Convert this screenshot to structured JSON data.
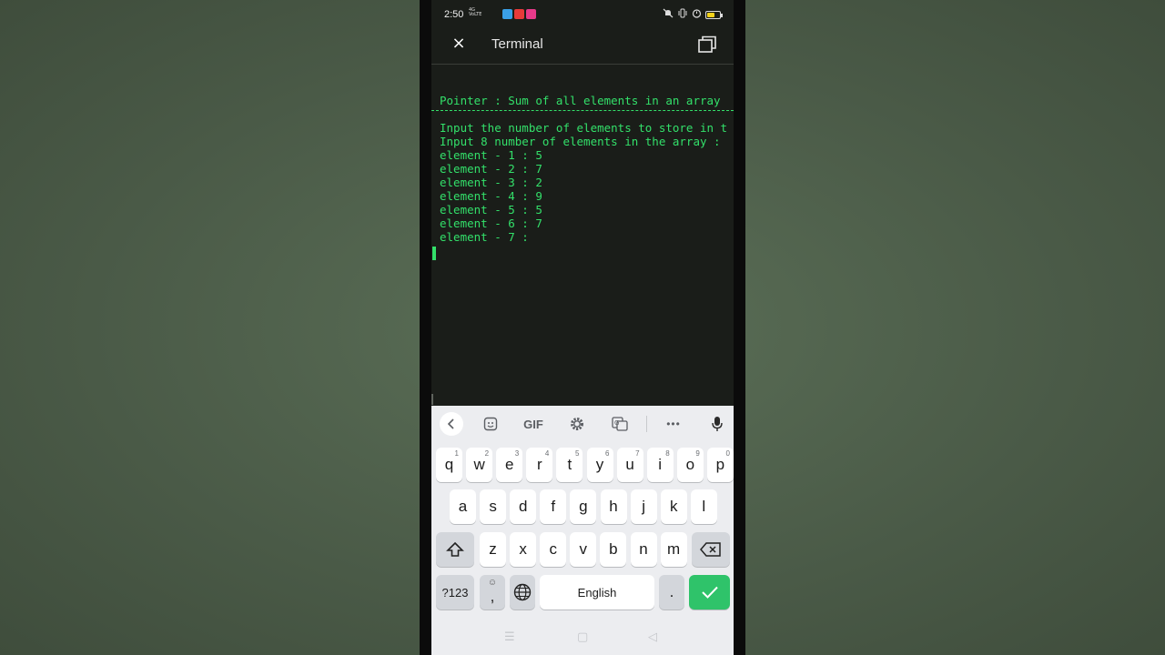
{
  "status_bar": {
    "time": "2:50",
    "net_top": "4G",
    "net_bottom": "VoLTE",
    "notification_colors": [
      "#3aa0e8",
      "#e83a3a",
      "#e83a8a"
    ],
    "battery_level": 0.6,
    "battery_color": "#f2d21b",
    "icons": [
      "mute-icon",
      "vibrate-icon",
      "alarm-icon",
      "battery-icon"
    ]
  },
  "app_bar": {
    "close_symbol": "×",
    "title": "Terminal",
    "window_icon": "window-icon"
  },
  "terminal": {
    "color": "#33e06a",
    "header": "Pointer : Sum of all elements in an array",
    "lines": [
      "Input the number of elements to store in t",
      "Input 8 number of elements in the array :",
      "element - 1 : 5",
      "element - 2 : 7",
      "element - 3 : 2",
      "element - 4 : 9",
      "element - 5 : 5",
      "element - 6 : 7",
      "element - 7 :"
    ]
  },
  "keyboard": {
    "toolbar": [
      "back-icon",
      "sticker-icon",
      "GIF",
      "settings-icon",
      "translate-icon",
      "more-icon",
      "mic-icon"
    ],
    "gif_label": "GIF",
    "more_label": "•••",
    "row1": [
      {
        "k": "q",
        "h": "1"
      },
      {
        "k": "w",
        "h": "2"
      },
      {
        "k": "e",
        "h": "3"
      },
      {
        "k": "r",
        "h": "4"
      },
      {
        "k": "t",
        "h": "5"
      },
      {
        "k": "y",
        "h": "6"
      },
      {
        "k": "u",
        "h": "7"
      },
      {
        "k": "i",
        "h": "8"
      },
      {
        "k": "o",
        "h": "9"
      },
      {
        "k": "p",
        "h": "0"
      }
    ],
    "row2": [
      "a",
      "s",
      "d",
      "f",
      "g",
      "h",
      "j",
      "k",
      "l"
    ],
    "row3": [
      "z",
      "x",
      "c",
      "v",
      "b",
      "n",
      "m"
    ],
    "sym_label": "?123",
    "comma_label": ",",
    "emoji_hint": "☺",
    "space_label": "English",
    "period_label": ".",
    "enter_color": "#2fc36a"
  },
  "nav_bar": {
    "menu": "☰",
    "home": "▢",
    "back": "◁"
  }
}
